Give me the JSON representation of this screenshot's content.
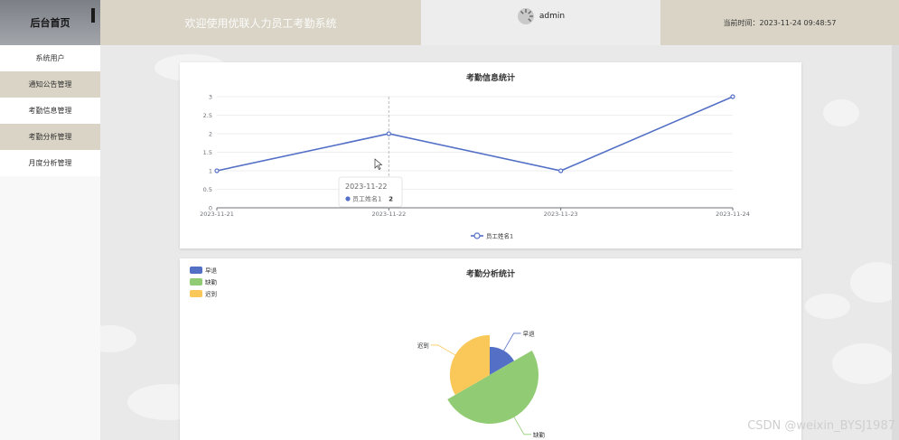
{
  "header": {
    "brand": "后台首页",
    "welcome": "欢迎使用优联人力员工考勤系统",
    "user": "admin",
    "time_label": "当前时间：",
    "time_value": "2023-11-24 09:48:57"
  },
  "sidebar": {
    "items": [
      {
        "label": "系统用户"
      },
      {
        "label": "通知公告管理"
      },
      {
        "label": "考勤信息管理"
      },
      {
        "label": "考勤分析管理"
      },
      {
        "label": "月度分析管理"
      }
    ]
  },
  "line_card": {
    "title": "考勤信息统计",
    "tooltip": {
      "date": "2023-11-22",
      "series": "员工姓名1",
      "value": "2"
    }
  },
  "pie_card": {
    "title": "考勤分析统计"
  },
  "chart_data": [
    {
      "type": "line",
      "title": "考勤信息统计",
      "x": [
        "2023-11-21",
        "2023-11-22",
        "2023-11-23",
        "2023-11-24"
      ],
      "series": [
        {
          "name": "员工姓名1",
          "values": [
            1,
            2,
            1,
            3
          ],
          "color": "#5470c6"
        }
      ],
      "ylim": [
        0,
        3
      ],
      "yticks": [
        "0",
        "0.5",
        "1",
        "1.5",
        "2",
        "2.5",
        "3"
      ],
      "grid": true,
      "legend": "bottom-center"
    },
    {
      "type": "pie",
      "title": "考勤分析统计",
      "rose": true,
      "slices": [
        {
          "label": "早退",
          "value": 1,
          "color": "#5470c6"
        },
        {
          "label": "缺勤",
          "value": 3,
          "color": "#91cc75"
        },
        {
          "label": "迟到",
          "value": 2,
          "color": "#fac858"
        }
      ],
      "legend": "top-left"
    }
  ],
  "watermark": "CSDN @weixin_BYSJ1987"
}
